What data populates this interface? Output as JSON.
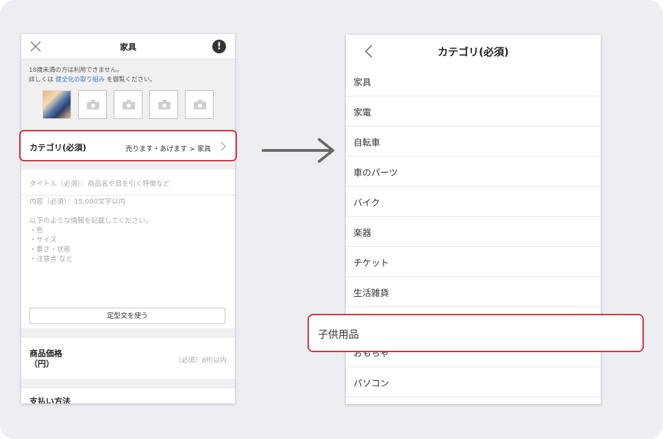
{
  "left_screen": {
    "title": "家具",
    "alert_glyph": "!",
    "notice_line1": "18歳未満の方は利用できません。",
    "notice_prefix": "詳しくは",
    "notice_link": "健全化の取り組み",
    "notice_suffix": "を御覧ください。",
    "category_label": "カテゴリ(必須)",
    "category_value": "売ります・あげます > 家具",
    "title_placeholder": "タイトル（必須）：商品名や目を引く特徴など",
    "body_placeholder": "内容（必須）：15,000文字以内\n\n以下のような情報を記載してください。\n・色\n・サイズ\n・重さ・状態\n・注意点 など",
    "template_button": "定型文を使う",
    "price_label": "商品価格\n（円）",
    "price_hint": "（必須）8桁以内",
    "payment_label": "支払い方法"
  },
  "right_screen": {
    "title": "カテゴリ(必須)",
    "categories": [
      {
        "label": "家具"
      },
      {
        "label": "家電"
      },
      {
        "label": "自転車"
      },
      {
        "label": "車のパーツ"
      },
      {
        "label": "バイク"
      },
      {
        "label": "楽器"
      },
      {
        "label": "チケット"
      },
      {
        "label": "生活雑貨"
      },
      {
        "label": "子供用品"
      },
      {
        "label": "おもちゃ"
      },
      {
        "label": "パソコン"
      }
    ],
    "highlighted_category": "子供用品"
  },
  "colors": {
    "highlight_border": "#d0323a",
    "link": "#3d7cd6",
    "arrow": "#666666",
    "background": "#ededf2"
  },
  "icons": {
    "close": "close-icon",
    "alert": "alert-icon",
    "camera": "camera-icon",
    "chevron": "chevron-right-icon",
    "back": "back-icon",
    "arrow": "arrow-right-icon"
  }
}
